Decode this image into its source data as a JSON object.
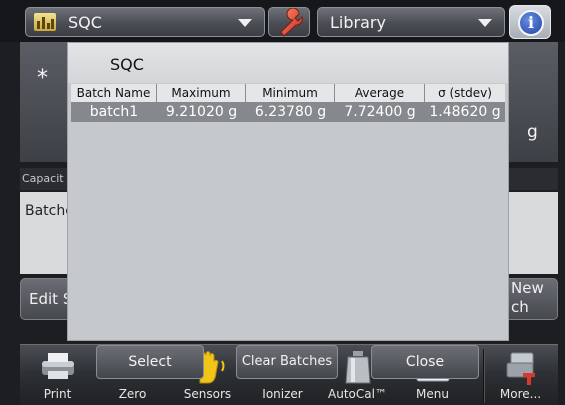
{
  "topbar": {
    "app_label": "SQC",
    "app_icon": "bar-chart-icon",
    "settings_icon": "wrench-icon",
    "library_label": "Library",
    "info_icon": "info-icon",
    "info_glyph": "i"
  },
  "background": {
    "asterisk": "*",
    "unit": "g",
    "capacity_label": "Capacit",
    "batches_label": "Batche",
    "edit_button": "Edit S",
    "new_button_line1": "New",
    "new_button_line2": "ch"
  },
  "dialog": {
    "title": "SQC",
    "table": {
      "columns": [
        "Batch Name",
        "Maximum",
        "Minimum",
        "Average",
        "σ (stdev)"
      ],
      "rows": [
        [
          "batch1",
          "9.21020 g",
          "6.23780 g",
          "7.72400 g",
          "1.48620 g"
        ]
      ]
    },
    "buttons": {
      "select": "Select",
      "clear": "Clear Batches",
      "close": "Close"
    }
  },
  "toolbar": {
    "items": [
      {
        "label": "Print",
        "icon": "printer-icon"
      },
      {
        "label": "Zero",
        "icon": "zero-icon"
      },
      {
        "label": "Sensors",
        "icon": "hand-sensor-icon"
      },
      {
        "label": "Ionizer",
        "icon": "ionizer-icon"
      },
      {
        "label": "AutoCal™",
        "icon": "weight-icon"
      },
      {
        "label": "Menu",
        "icon": "menu-list-icon"
      },
      {
        "label": "More...",
        "icon": "more-tools-icon"
      }
    ]
  },
  "colors": {
    "selected_row": "#85898d",
    "dialog_bg": "#c2c5c8",
    "accent_yellow": "#f0c419"
  }
}
